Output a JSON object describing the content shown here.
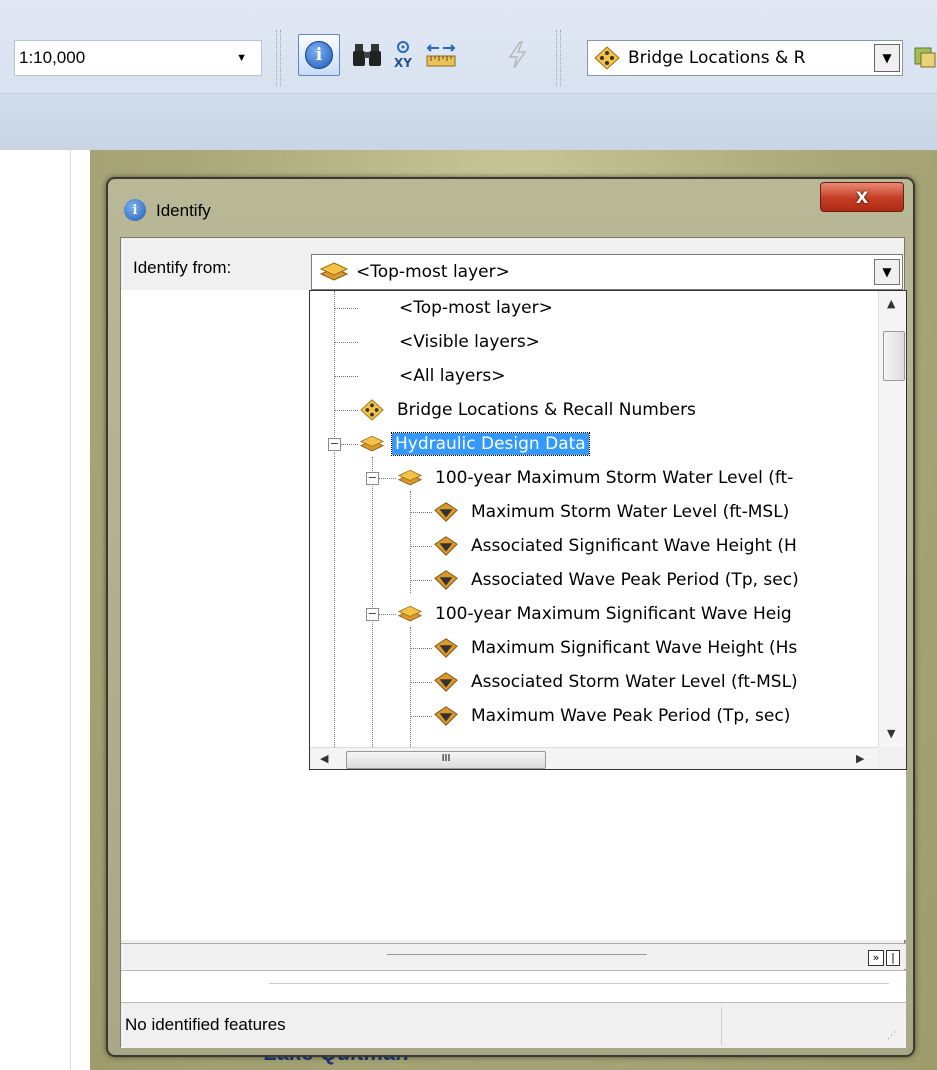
{
  "toolbar": {
    "scale_value": "1:10,000",
    "layer_select": "Bridge Locations & R",
    "buttons": [
      "identify-tool",
      "find-tool",
      "go-to-xy-tool",
      "measure-tool",
      "hyperlink-tool"
    ],
    "icons": {
      "find": "binoculars",
      "goto": "XY",
      "measure": "ruler"
    }
  },
  "map": {
    "label": "Lake Quitman"
  },
  "dialog": {
    "title": "Identify",
    "close_label": "X",
    "identify_from_label": "Identify from:",
    "identify_from_value": "<Top-most layer>",
    "dropdown_items": [
      {
        "label": "<Top-most layer>",
        "icon": "none"
      },
      {
        "label": "<Visible layers>",
        "icon": "none"
      },
      {
        "label": "<All layers>",
        "icon": "none"
      },
      {
        "label": "Bridge Locations & Recall Numbers",
        "icon": "point-layer"
      },
      {
        "label": "Hydraulic Design Data",
        "icon": "group-layer",
        "selected": true
      },
      {
        "label": "100-year Maximum Storm Water Level (ft-",
        "icon": "group-layer"
      },
      {
        "label": "Maximum Storm Water Level (ft-MSL)",
        "icon": "raster-layer"
      },
      {
        "label": "Associated  Significant Wave Height (H",
        "icon": "raster-layer"
      },
      {
        "label": "Associated Wave Peak Period (Tp, sec)",
        "icon": "raster-layer"
      },
      {
        "label": "100-year Maximum Significant Wave Heig",
        "icon": "group-layer"
      },
      {
        "label": "Maximum Significant Wave Height (Hs",
        "icon": "raster-layer"
      },
      {
        "label": "Associated Storm Water Level (ft-MSL)",
        "icon": "raster-layer"
      },
      {
        "label": "Maximum Wave Peak Period (Tp, sec)",
        "icon": "raster-layer"
      }
    ],
    "hscroll_thumb": "III",
    "collapse_label": "»",
    "status": "No identified features"
  }
}
